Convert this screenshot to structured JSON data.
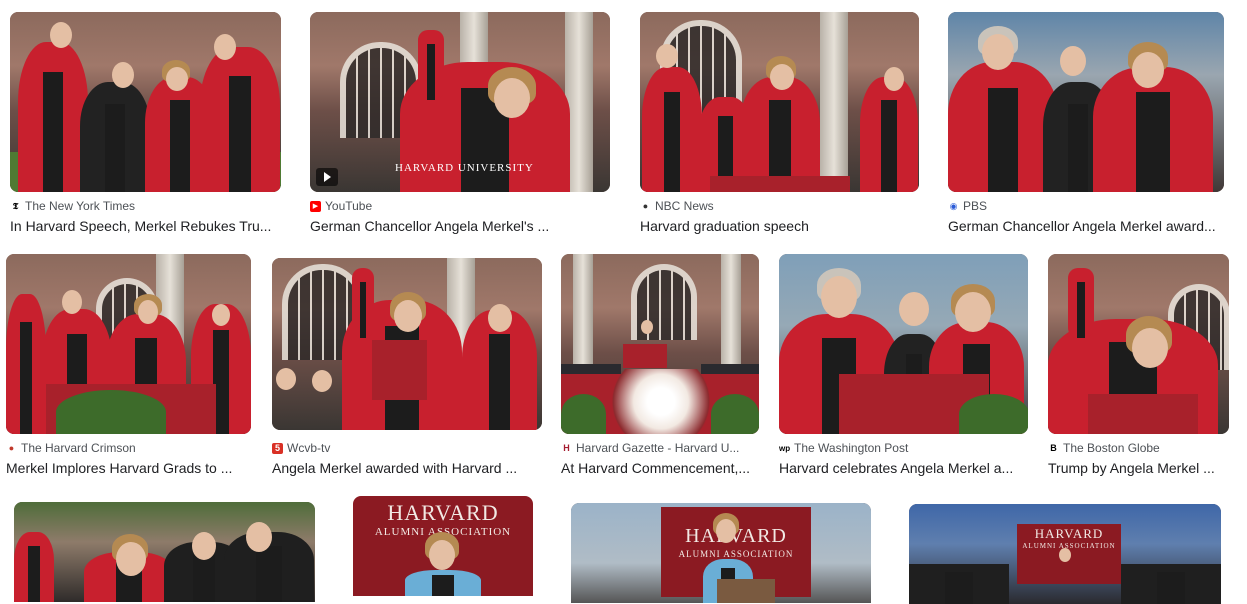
{
  "results": [
    {
      "source": "The New York Times",
      "title": "In Harvard Speech, Merkel Rebukes Tru...",
      "fav": "𝕿",
      "favcolor": "#000000"
    },
    {
      "source": "YouTube",
      "title": "German Chancellor Angela Merkel's ...",
      "fav": "▶",
      "favcolor": "#ff0000",
      "overlay": "HARVARD UNIVERSITY"
    },
    {
      "source": "NBC News",
      "title": "Harvard graduation speech",
      "fav": "●",
      "favcolor": "#333333"
    },
    {
      "source": "PBS",
      "title": "German Chancellor Angela Merkel award...",
      "fav": "◉",
      "favcolor": "#2a5bd7"
    },
    {
      "source": "The Harvard Crimson",
      "title": "Merkel Implores Harvard Grads to ...",
      "fav": "●",
      "favcolor": "#c0392b"
    },
    {
      "source": "Wcvb-tv",
      "title": "Angela Merkel awarded with Harvard ...",
      "fav": "5",
      "favcolor": "#d93025"
    },
    {
      "source": "Harvard Gazette - Harvard U...",
      "title": "At Harvard Commencement,...",
      "fav": "H",
      "favcolor": "#a51c30"
    },
    {
      "source": "The Washington Post",
      "title": "Harvard celebrates Angela Merkel a...",
      "fav": "wp",
      "favcolor": "#000000"
    },
    {
      "source": "The Boston Globe",
      "title": "Trump by Angela Merkel ...",
      "fav": "B",
      "favcolor": "#000000"
    },
    {
      "source": "",
      "title": ""
    },
    {
      "source": "",
      "title": "",
      "banner1": "HARVARD",
      "banner2": "ALUMNI ASSOCIATION"
    },
    {
      "source": "",
      "title": "",
      "banner1": "HARVARD",
      "banner2": "ALUMNI ASSOCIATION"
    },
    {
      "source": "",
      "title": "",
      "banner1": "HARVARD",
      "banner2": "ALUMNI ASSOCIATION"
    }
  ]
}
